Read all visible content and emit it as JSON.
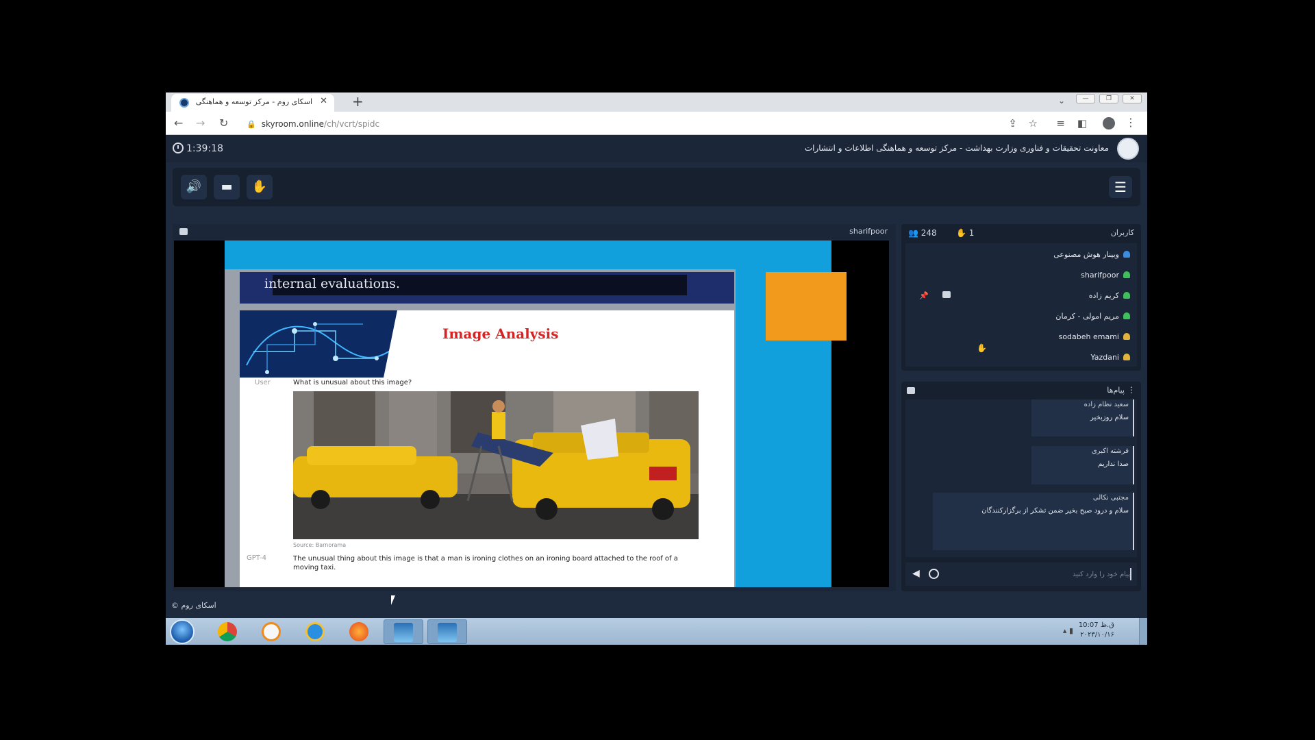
{
  "browser": {
    "tab_title": "اسکای روم - مرکز توسعه و هماهنگی",
    "tab_close": "✕",
    "new_tab": "+",
    "url_host": "skyroom.online",
    "url_path": "/ch/vcrt/spidc"
  },
  "header": {
    "timer": "1:39:18",
    "org_title": "معاونت تحقیقات و فناوری وزارت بهداشت - مرکز توسعه و هماهنگی اطلاعات و انتشارات"
  },
  "presentation": {
    "presenter": "sharifpoor",
    "slide_top_text": "internal evaluations.",
    "slide_title": "Image Analysis",
    "user_label": "User",
    "question": "What is unusual about this image?",
    "photo_source": "Source: Barnorama",
    "gpt_label": "GPT-4",
    "answer": "The unusual thing about this image is that a man is ironing clothes on an ironing board attached to the roof of a moving taxi."
  },
  "users": {
    "title": "کاربران",
    "count": "248",
    "hands": "1",
    "list": [
      {
        "name": "وبینار هوش مصنوعی",
        "color": "#3b8de0"
      },
      {
        "name": "sharifpoor",
        "color": "#3fbf5a"
      },
      {
        "name": "کریم زاده",
        "color": "#3fbf5a"
      },
      {
        "name": "مریم امولی - کرمان",
        "color": "#3fbf5a"
      },
      {
        "name": "sodabeh emami",
        "color": "#e0b33b"
      },
      {
        "name": "Yazdani",
        "color": "#e0b33b"
      }
    ]
  },
  "messages": {
    "title": "پیام‌ها",
    "items": [
      {
        "sender": "سعید نظام زاده",
        "text": "سلام روزبخیر"
      },
      {
        "sender": "فرشته اکبری",
        "text": "صدا نداریم"
      },
      {
        "sender": "مجتبی نکالی",
        "text": "سلام و درود صبح بخیر ضمن تشکر از برگزارکنندگان"
      }
    ],
    "input_placeholder": "پیام خود را وارد کنید"
  },
  "footer": {
    "brand": "اسکای روم ©"
  },
  "taskbar": {
    "time": "10:07 ق.ظ",
    "date": "۲۰۲۳/۱۰/۱۶"
  },
  "colors": {
    "slide_blue": "#12a0dd",
    "slide_orange": "#f29a1c",
    "title_red": "#d62424",
    "app_bg": "#1e2a3d"
  }
}
